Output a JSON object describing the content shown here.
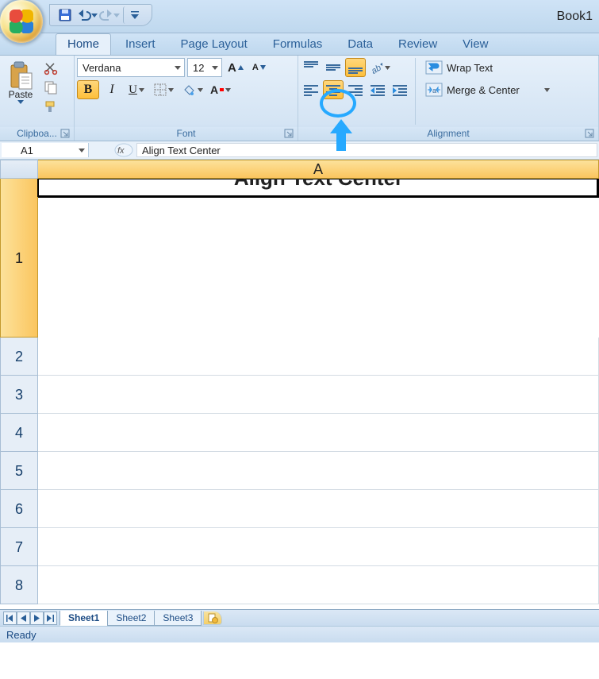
{
  "window": {
    "title": "Book1"
  },
  "qat": {
    "items": [
      "save",
      "undo",
      "redo",
      "customize"
    ]
  },
  "tabs": [
    "Home",
    "Insert",
    "Page Layout",
    "Formulas",
    "Data",
    "Review",
    "View"
  ],
  "active_tab": "Home",
  "ribbon": {
    "clipboard": {
      "label": "Clipboa...",
      "paste": "Paste"
    },
    "font": {
      "label": "Font",
      "name": "Verdana",
      "size": "12"
    },
    "alignment": {
      "label": "Alignment",
      "wrap": "Wrap Text",
      "merge": "Merge & Center"
    }
  },
  "namebox": "A1",
  "formula_bar": "Align Text Center",
  "columns": [
    "A"
  ],
  "rows": [
    "1",
    "2",
    "3",
    "4",
    "5",
    "6",
    "7",
    "8"
  ],
  "cell_A1": "Align Text Center",
  "sheet_tabs": [
    "Sheet1",
    "Sheet2",
    "Sheet3"
  ],
  "active_sheet": "Sheet1",
  "status": "Ready"
}
